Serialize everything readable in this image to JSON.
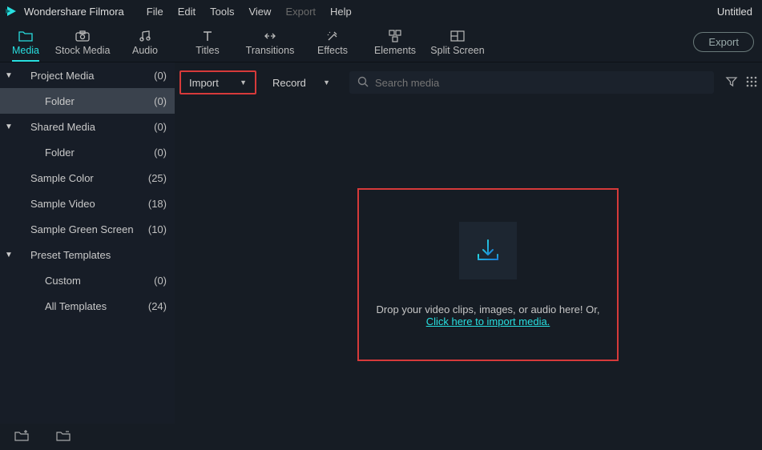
{
  "titlebar": {
    "app_name": "Wondershare Filmora",
    "menus": [
      "File",
      "Edit",
      "Tools",
      "View",
      "Export",
      "Help"
    ],
    "menus_disabled_index": 4,
    "project_title": "Untitled"
  },
  "tabs": [
    {
      "id": "media",
      "label": "Media",
      "active": true
    },
    {
      "id": "stock-media",
      "label": "Stock Media",
      "active": false
    },
    {
      "id": "audio",
      "label": "Audio",
      "active": false
    },
    {
      "id": "titles",
      "label": "Titles",
      "active": false
    },
    {
      "id": "transitions",
      "label": "Transitions",
      "active": false
    },
    {
      "id": "effects",
      "label": "Effects",
      "active": false
    },
    {
      "id": "elements",
      "label": "Elements",
      "active": false
    },
    {
      "id": "split-screen",
      "label": "Split Screen",
      "active": false
    }
  ],
  "export_button": "Export",
  "sidebar": {
    "items": [
      {
        "label": "Project Media",
        "count": "(0)"
      },
      {
        "label": "Folder",
        "count": "(0)"
      },
      {
        "label": "Shared Media",
        "count": "(0)"
      },
      {
        "label": "Folder",
        "count": "(0)"
      },
      {
        "label": "Sample Color",
        "count": "(25)"
      },
      {
        "label": "Sample Video",
        "count": "(18)"
      },
      {
        "label": "Sample Green Screen",
        "count": "(10)"
      },
      {
        "label": "Preset Templates",
        "count": ""
      },
      {
        "label": "Custom",
        "count": "(0)"
      },
      {
        "label": "All Templates",
        "count": "(24)"
      }
    ]
  },
  "actions": {
    "import_label": "Import",
    "record_label": "Record",
    "search_placeholder": "Search media"
  },
  "dropzone": {
    "text": "Drop your video clips, images, or audio here! Or,",
    "link": "Click here to import media."
  }
}
